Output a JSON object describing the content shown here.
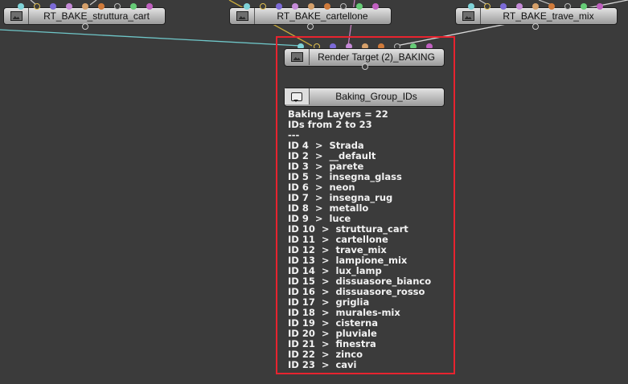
{
  "nodes": {
    "left": {
      "title": "RT_BAKE_struttura_cart"
    },
    "center": {
      "title": "RT_BAKE_cartellone"
    },
    "right": {
      "title": "RT_BAKE_trave_mix"
    },
    "render_target": {
      "title": "Render Target (2)_BAKING"
    },
    "comment": {
      "title": "Baking_Group_IDs"
    }
  },
  "comment_body": [
    "Baking Layers = 22",
    "IDs from 2 to 23",
    "---",
    "ID 4  >  Strada",
    "ID 2  >  __default",
    "ID 3  >  parete",
    "ID 5  >  insegna_glass",
    "ID 6  >  neon",
    "ID 7  >  insegna_rug",
    "ID 8  >  metallo",
    "ID 9  >  luce",
    "ID 10  >  struttura_cart",
    "ID 11  >  cartellone",
    "ID 12  >  trave_mix",
    "ID 13  >  lampione_mix",
    "ID 14  >  lux_lamp",
    "ID 15  >  dissuasore_bianco",
    "ID 16  >  dissuasore_rosso",
    "ID 17  >  griglia",
    "ID 18  >  murales-mix",
    "ID 19  >  cisterna",
    "ID 20  >  pluviale",
    "ID 21  >  finestra",
    "ID 22  >  zinco",
    "ID 23  >  cavi"
  ],
  "port_colors": [
    "#7fd3d8",
    "#e0c050",
    "#7c6ad8",
    "#c58ad8",
    "#d6a06a",
    "#d07a3a",
    "#bdbdbd",
    "#66cc77",
    "#c060c0"
  ],
  "wire_colors": {
    "cyan": "#6fc7c9",
    "yellow": "#c8aa3c",
    "pink": "#c77fbf",
    "white": "#d9d9d9"
  },
  "highlight_color": "#e8232f"
}
